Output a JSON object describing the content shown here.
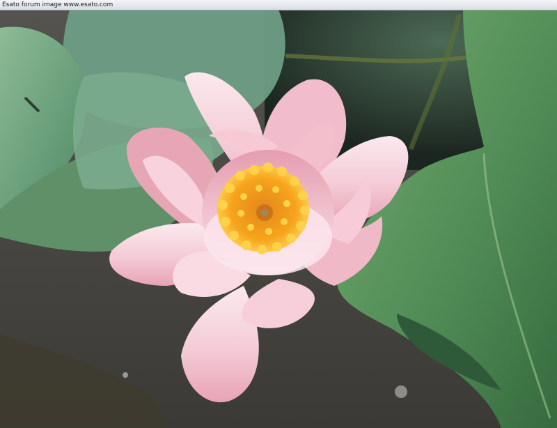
{
  "banner": {
    "text": "Esato forum image www.esato.com"
  },
  "photo": {
    "subject": "pink water lily",
    "colors": {
      "petal_light": "#fbe9ee",
      "petal_mid": "#f2c3cf",
      "petal_deep": "#e79fb2",
      "stamen": "#f6a41c",
      "stamen_tip": "#ffd24a",
      "leaf": "#4f8a55",
      "leaf_light": "#7fb07e",
      "stone": "#4a4946",
      "water": "#2b3a2e"
    }
  }
}
